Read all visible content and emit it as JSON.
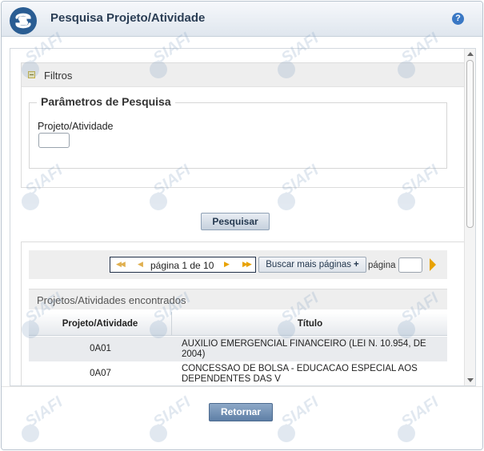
{
  "window": {
    "title": "Pesquisa Projeto/Atividade",
    "help_glyph": "?",
    "watermark_text": "SIAFI"
  },
  "filters": {
    "toggle_label": "Filtros",
    "section_title": "Parâmetros de Pesquisa",
    "field_label": "Projeto/Atividade",
    "field_value": ""
  },
  "actions": {
    "search_label": "Pesquisar",
    "return_label": "Retornar"
  },
  "pager": {
    "first_glyph": "◀◀",
    "prev_glyph": "◀",
    "status_text": "página 1 de 10",
    "next_glyph": "▶",
    "last_glyph": "▶▶",
    "more_pages_label": "Buscar mais páginas",
    "more_pages_glyph": "+",
    "page_label": "página",
    "page_value": "",
    "current_page": 1,
    "total_pages": 10
  },
  "results": {
    "caption": "Projetos/Atividades encontrados",
    "columns": [
      "Projeto/Atividade",
      "Título"
    ],
    "rows": [
      {
        "code": "0A01",
        "title": "AUXILIO EMERGENCIAL FINANCEIRO (LEI N. 10.954, DE 2004)"
      },
      {
        "code": "0A07",
        "title": "CONCESSAO DE BOLSA - EDUCACAO ESPECIAL AOS DEPENDENTES DAS V"
      }
    ]
  },
  "colors": {
    "title_text": "#2b3e55",
    "logo": "#2a5d93",
    "help_icon": "#3a78c4",
    "pager_arrow": "#e8a200",
    "return_button": "#5e7fa6"
  },
  "icons": [
    "siafi-logo-icon",
    "help-icon",
    "collapse-minus-icon",
    "first-page-icon",
    "prev-page-icon",
    "next-page-icon",
    "last-page-icon",
    "plus-icon",
    "go-page-icon"
  ]
}
